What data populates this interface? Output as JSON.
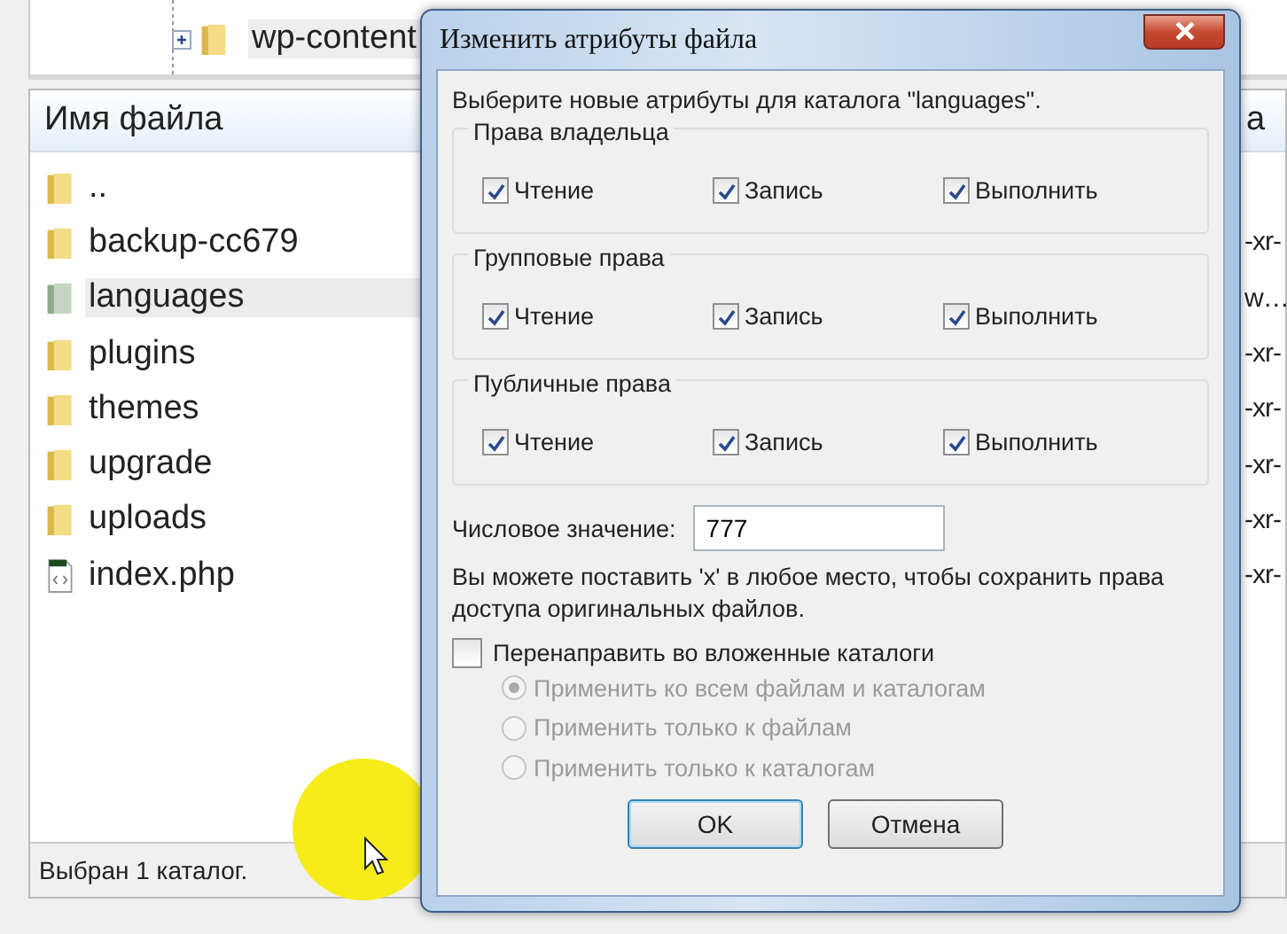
{
  "tree": {
    "items": [
      {
        "label": "wp-content",
        "expanded": false
      }
    ]
  },
  "file_list": {
    "columns": [
      "Имя файла",
      "a"
    ],
    "rows": [
      {
        "name": "..",
        "kind": "folder",
        "selected": false
      },
      {
        "name": "backup-cc679",
        "kind": "folder",
        "column_2": "-xr-",
        "selected": false
      },
      {
        "name": "languages",
        "kind": "folder",
        "column_2": "w…",
        "selected": true
      },
      {
        "name": "plugins",
        "kind": "folder",
        "column_2": "-xr-",
        "selected": false
      },
      {
        "name": "themes",
        "kind": "folder",
        "column_2": "-xr-",
        "selected": false
      },
      {
        "name": "upgrade",
        "kind": "folder",
        "column_2": "-xr-",
        "selected": false
      },
      {
        "name": "uploads",
        "kind": "folder",
        "column_2": "-xr-",
        "selected": false
      },
      {
        "name": "index.php",
        "kind": "file",
        "column_2": "-xr-",
        "selected": false
      }
    ]
  },
  "status_bar": "Выбран 1 каталог.",
  "dialog": {
    "title": "Изменить атрибуты файла",
    "intro": "Выберите новые атрибуты для каталога \"languages\".",
    "groups": [
      {
        "title": "Права владельца",
        "permissions": [
          {
            "label": "Чтение",
            "checked": true
          },
          {
            "label": "Запись",
            "checked": true
          },
          {
            "label": "Выполнить",
            "checked": true
          }
        ]
      },
      {
        "title": "Групповые права",
        "permissions": [
          {
            "label": "Чтение",
            "checked": true
          },
          {
            "label": "Запись",
            "checked": true
          },
          {
            "label": "Выполнить",
            "checked": true
          }
        ]
      },
      {
        "title": "Публичные права",
        "permissions": [
          {
            "label": "Чтение",
            "checked": true
          },
          {
            "label": "Запись",
            "checked": true
          },
          {
            "label": "Выполнить",
            "checked": true
          }
        ]
      }
    ],
    "numeric": {
      "label": "Числовое значение:",
      "value": "777"
    },
    "hint": "Вы можете поставить 'x' в любое место, чтобы сохранить права доступа оригинальных файлов.",
    "recursive": {
      "label": "Перенаправить во вложенные каталоги",
      "checked": false
    },
    "apply_options": [
      {
        "label": "Применить ко всем файлам и каталогам",
        "selected": true,
        "disabled": true
      },
      {
        "label": "Применить только к файлам",
        "selected": false,
        "disabled": true
      },
      {
        "label": "Применить только к каталогам",
        "selected": false,
        "disabled": true
      }
    ],
    "buttons": [
      {
        "label": "OK",
        "default": true
      },
      {
        "label": "Отмена",
        "default": false
      }
    ]
  }
}
